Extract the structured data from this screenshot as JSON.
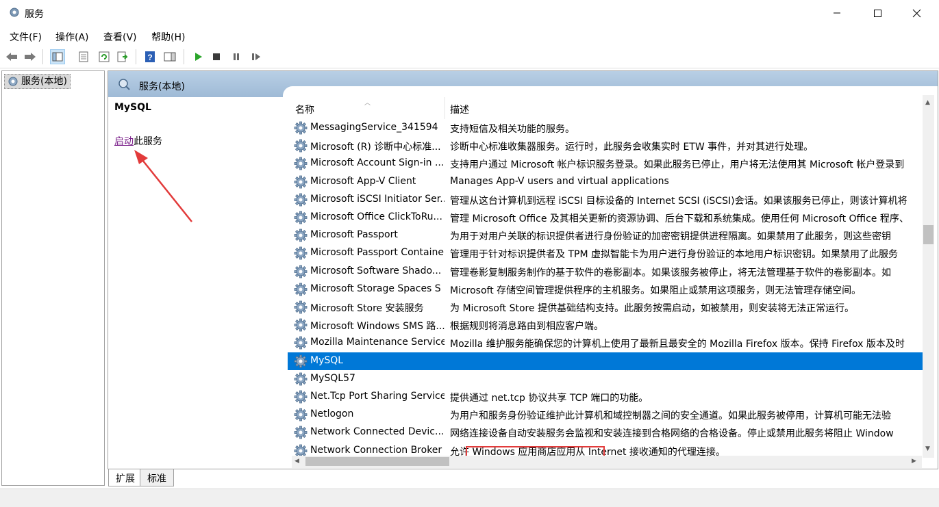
{
  "window": {
    "title": "服务"
  },
  "menubar": {
    "items": [
      {
        "label": "文件(F)"
      },
      {
        "label": "操作(A)"
      },
      {
        "label": "查看(V)"
      },
      {
        "label": "帮助(H)"
      }
    ]
  },
  "toolbar": {
    "icons": [
      "back-icon",
      "forward-icon",
      "show-hide-console-tree-icon",
      "properties-icon",
      "refresh-icon",
      "export-list-icon",
      "help-icon",
      "show-hide-action-pane-icon",
      "start-service-icon",
      "stop-service-icon",
      "pause-service-icon",
      "resume-service-icon"
    ]
  },
  "tree": {
    "root_label": "服务(本地)"
  },
  "content": {
    "header_title": "服务(本地)",
    "selected_service_name": "MySQL",
    "action_link": "启动",
    "action_suffix": "此服务"
  },
  "list": {
    "columns": {
      "name": "名称",
      "description": "描述"
    },
    "rows": [
      {
        "name": "MessagingService_341594",
        "description": "支持短信及相关功能的服务。"
      },
      {
        "name": "Microsoft (R) 诊断中心标准...",
        "description": "诊断中心标准收集器服务。运行时，此服务会收集实时 ETW 事件，并对其进行处理。"
      },
      {
        "name": "Microsoft Account Sign-in ...",
        "description": "支持用户通过 Microsoft 帐户标识服务登录。如果此服务已停止，用户将无法使用其 Microsoft 帐户登录到"
      },
      {
        "name": "Microsoft App-V Client",
        "description": "Manages App-V users and virtual applications"
      },
      {
        "name": "Microsoft iSCSI Initiator Ser...",
        "description": "管理从这台计算机到远程 iSCSI 目标设备的 Internet SCSI (iSCSI)会话。如果该服务已停止，则该计算机将"
      },
      {
        "name": "Microsoft Office ClickToRu...",
        "description": "管理 Microsoft Office 及其相关更新的资源协调、后台下载和系统集成。使用任何 Microsoft Office 程序、"
      },
      {
        "name": "Microsoft Passport",
        "description": "为用于对用户关联的标识提供者进行身份验证的加密密钥提供进程隔离。如果禁用了此服务，则这些密钥"
      },
      {
        "name": "Microsoft Passport Container",
        "description": "管理用于针对标识提供者及 TPM 虚拟智能卡为用户进行身份验证的本地用户标识密钥。如果禁用了此服务"
      },
      {
        "name": "Microsoft Software Shado...",
        "description": "管理卷影复制服务制作的基于软件的卷影副本。如果该服务被停止，将无法管理基于软件的卷影副本。如"
      },
      {
        "name": "Microsoft Storage Spaces S",
        "description": "Microsoft 存储空间管理提供程序的主机服务。如果阻止或禁用这项服务，则无法管理存储空间。"
      },
      {
        "name": "Microsoft Store 安装服务",
        "description": "为 Microsoft Store 提供基础结构支持。此服务按需启动，如被禁用，则安装将无法正常运行。"
      },
      {
        "name": "Microsoft Windows SMS 路...",
        "description": "根据规则将消息路由到相应客户端。"
      },
      {
        "name": "Mozilla Maintenance Service",
        "description": "Mozilla 维护服务能确保您的计算机上使用了最新且最安全的 Mozilla Firefox 版本。保持 Firefox 版本及时"
      },
      {
        "name": "MySQL",
        "description": "",
        "selected": true
      },
      {
        "name": "MySQL57",
        "description": ""
      },
      {
        "name": "Net.Tcp Port Sharing Service",
        "description": "提供通过 net.tcp 协议共享 TCP 端口的功能。"
      },
      {
        "name": "Netlogon",
        "description": "为用户和服务身份验证维护此计算机和域控制器之间的安全通道。如果此服务被停用，计算机可能无法验"
      },
      {
        "name": "Network Connected Devic...",
        "description": "网络连接设备自动安装服务会监视和安装连接到合格网络的合格设备。停止或禁用此服务将阻止 Window"
      },
      {
        "name": "Network Connection Broker",
        "description": "允许 Windows 应用商店应用从 Internet 接收通知的代理连接。"
      }
    ]
  },
  "tabs": [
    {
      "label": "扩展"
    },
    {
      "label": "标准"
    }
  ],
  "colors": {
    "selection": "#0078d7",
    "header_band": "#9fbad6",
    "annotation": "#e23b3b",
    "link": "#7a1f8a"
  }
}
